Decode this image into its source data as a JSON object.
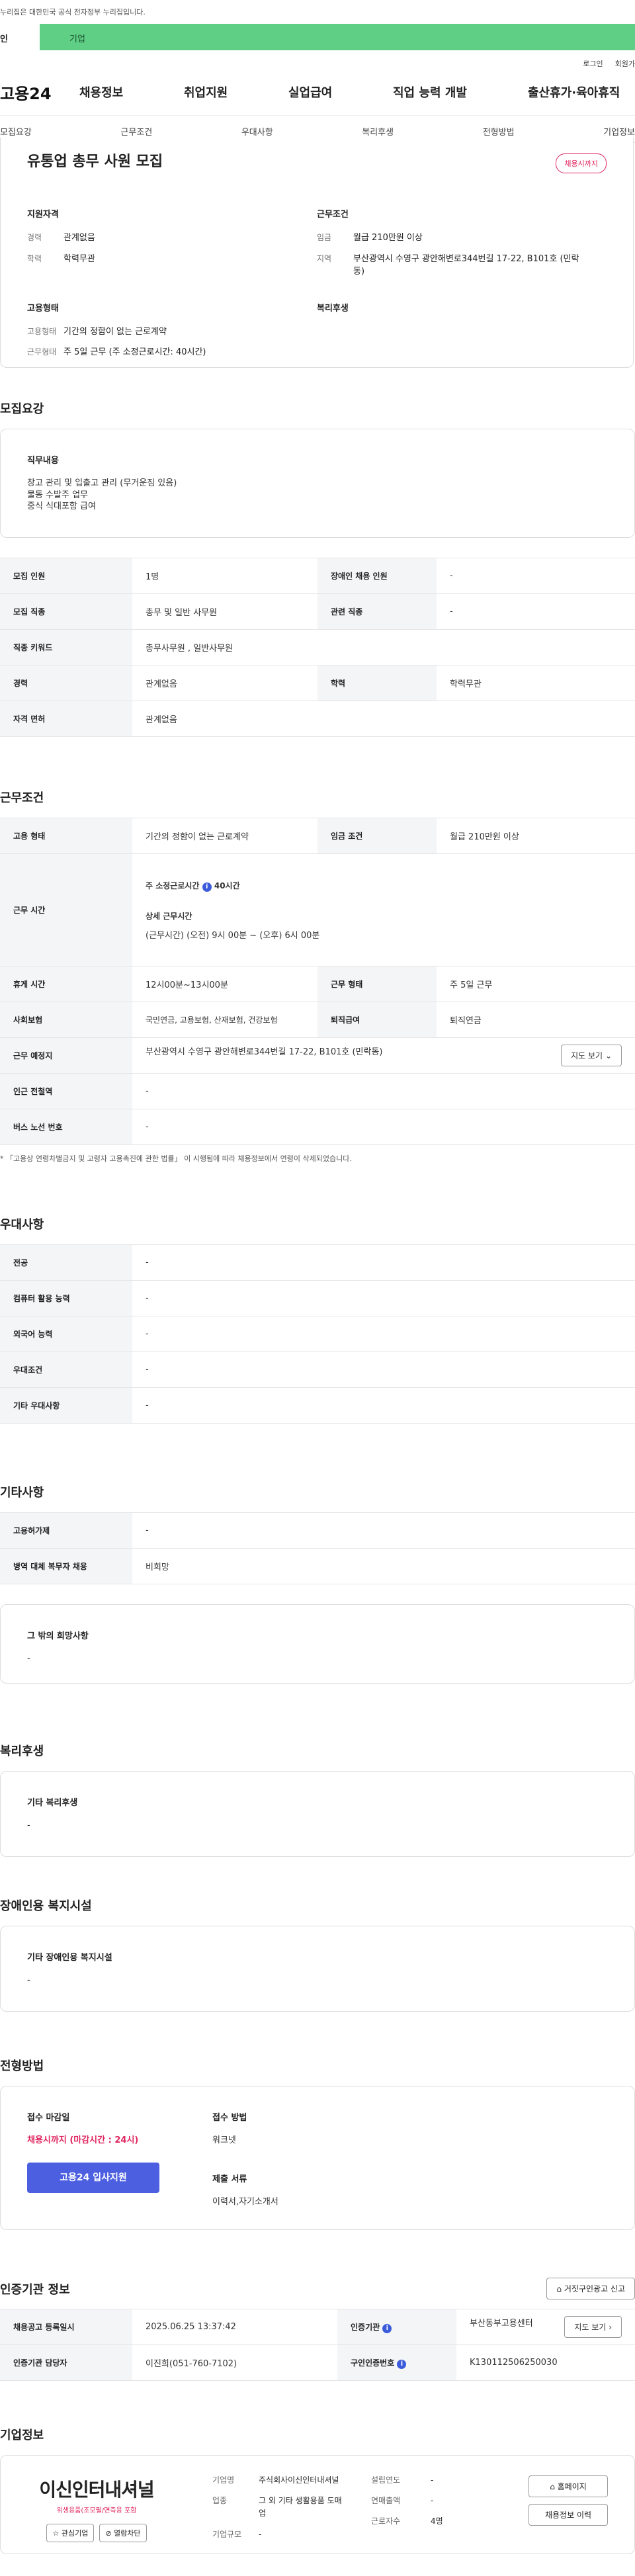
{
  "gov_banner": "누리집은 대한민국 공식 전자정부 누리집입니다.",
  "tabs": {
    "personal": "인",
    "company": "기업"
  },
  "util": [
    "로그인",
    "회원가"
  ],
  "logo": "고용24",
  "gnb": [
    "채용정보",
    "취업지원",
    "실업급여",
    "직업 능력 개발",
    "출산휴가·육아휴직"
  ],
  "subnav": [
    "모집요강",
    "근무조건",
    "우대사항",
    "복리후생",
    "전형방법",
    "기업정보"
  ],
  "summary": {
    "title": "유통업 총무 사원 모집",
    "badge": "채용시까지",
    "qual_title": "지원자격",
    "qual": [
      {
        "k": "경력",
        "v": "관계없음"
      },
      {
        "k": "학력",
        "v": "학력무관"
      }
    ],
    "cond_title": "근무조건",
    "cond": [
      {
        "k": "임금",
        "v": "월급 210만원 이상"
      },
      {
        "k": "지역",
        "v": "부산광역시 수영구 광안해변로344번길 17-22, B101호 (민락동)"
      }
    ],
    "emp_title": "고용형태",
    "emp": [
      {
        "k": "고용형태",
        "v": "기간의 정함이 없는 근로계약"
      },
      {
        "k": "근무형태",
        "v": "주 5일 근무 (주 소정근로시간: 40시간)"
      }
    ],
    "welfare_title": "복리후생"
  },
  "recruit": {
    "title": "모집요강",
    "duty_title": "직무내용",
    "duty_lines": [
      "창고 관리 및 입출고 관리 (무거운짐 있음)",
      "물동 수발주 업무",
      "중식 식대포함 급여"
    ],
    "rows": [
      {
        "k1": "모집 인원",
        "v1": "1명",
        "k2": "장애인 채용 인원",
        "v2": "-"
      },
      {
        "k1": "모집 직종",
        "v1": "총무 및 일반 사무원",
        "k2": "관련 직종",
        "v2": "-"
      },
      {
        "k1": "직종 키워드",
        "v1": "총무사무원 , 일반사무원",
        "k2": "",
        "v2": ""
      },
      {
        "k1": "경력",
        "v1": "관계없음",
        "k2": "학력",
        "v2": "학력무관"
      },
      {
        "k1": "자격 면허",
        "v1": "관계없음",
        "k2": "",
        "v2": ""
      }
    ]
  },
  "work": {
    "title": "근무조건",
    "emp_k": "고용 형태",
    "emp_v": "기간의 정함이 없는 근로계약",
    "wage_k": "임금 조건",
    "wage_v": "월급 210만원 이상",
    "hours_k": "근무 시간",
    "hours_main": "주 소정근로시간",
    "hours_main_val": "40시간",
    "hours_detail_title": "상세 근무시간",
    "hours_detail": "(근무시간) (오전) 9시 00분 ~ (오후) 6시 00분",
    "break_k": "휴게 시간",
    "break_v": "12시00분~13시00분",
    "form_k": "근무 형태",
    "form_v": "주 5일 근무",
    "ins_k": "사회보험",
    "ins_v": "국민연금, 고용보험, 산재보험, 건강보험",
    "ret_k": "퇴직급여",
    "ret_v": "퇴직연금",
    "loc_k": "근무 예정지",
    "loc_v": "부산광역시 수영구 광안해변로344번길 17-22, B101호 (민락동)",
    "map_btn": "지도 보기",
    "sub_k": "인근 전철역",
    "sub_v": "-",
    "bus_k": "버스 노선 번호",
    "bus_v": "-",
    "note": "* 「고용상 연령차별금지 및 고령자 고용촉진에 관한 법률」 이 시행됨에 따라 채용정보에서 연령이 삭제되었습니다."
  },
  "pref": {
    "title": "우대사항",
    "rows": [
      {
        "k": "전공",
        "v": "-"
      },
      {
        "k": "컴퓨터 활용 능력",
        "v": "-"
      },
      {
        "k": "외국어 능력",
        "v": "-"
      },
      {
        "k": "우대조건",
        "v": "-"
      },
      {
        "k": "기타 우대사항",
        "v": "-"
      }
    ]
  },
  "etc": {
    "title": "기타사항",
    "rows": [
      {
        "k": "고용허가제",
        "v": "-"
      },
      {
        "k": "병역 대체 복무자 채용",
        "v": "비희망"
      }
    ],
    "wish_title": "그 밖의 희망사항",
    "wish_v": "-"
  },
  "welfare": {
    "title": "복리후생",
    "box_title": "기타 복리후생",
    "v": "-"
  },
  "disab": {
    "title": "장애인용 복지시설",
    "box_title": "기타 장애인용 복지시설",
    "v": "-"
  },
  "selection": {
    "title": "전형방법",
    "deadline_title": "접수 마감일",
    "deadline_v": "채용시까지 (마감시간 : 24시)",
    "apply_btn": "고용24 입사지원",
    "method_title": "접수 방법",
    "method_v": "워크넷",
    "docs_title": "제출 서류",
    "docs_v": "이력서,자기소개서"
  },
  "cert": {
    "title": "인증기관 정보",
    "report_btn": "거짓구인광고 신고",
    "rows": [
      {
        "k1": "채용공고 등록일시",
        "v1": "2025.06.25 13:37:42",
        "k2": "인증기관",
        "v2": "부산동부고용센터",
        "btn": "지도 보기"
      },
      {
        "k1": "인증기관 담당자",
        "v1": "이진희(051-760-7102)",
        "k2": "구인인증번호",
        "v2": "K130112506250030",
        "btn": ""
      }
    ]
  },
  "company": {
    "title": "기업정보",
    "name": "이신인터내셔널",
    "tags": "위생용품(조모필/면측용 포함",
    "btn_fav": "관심기업",
    "btn_block": "열람차단",
    "f1_k": "기업명",
    "f1_v": "주식회사이신인터내셔널",
    "f2_k": "업종",
    "f2_v": "그 외 기타 생활용품 도매업",
    "f3_k": "기업규모",
    "f3_v": "-",
    "f4_k": "설립연도",
    "f4_v": "-",
    "f5_k": "연매출액",
    "f5_v": "-",
    "f6_k": "근로자수",
    "f6_v": "4명",
    "home_btn": "홈페이지",
    "info_btn": "채용정보 이력"
  },
  "colors": {
    "accent": "#4b5fe0",
    "green": "#5ecf84",
    "red": "#e0245e"
  }
}
